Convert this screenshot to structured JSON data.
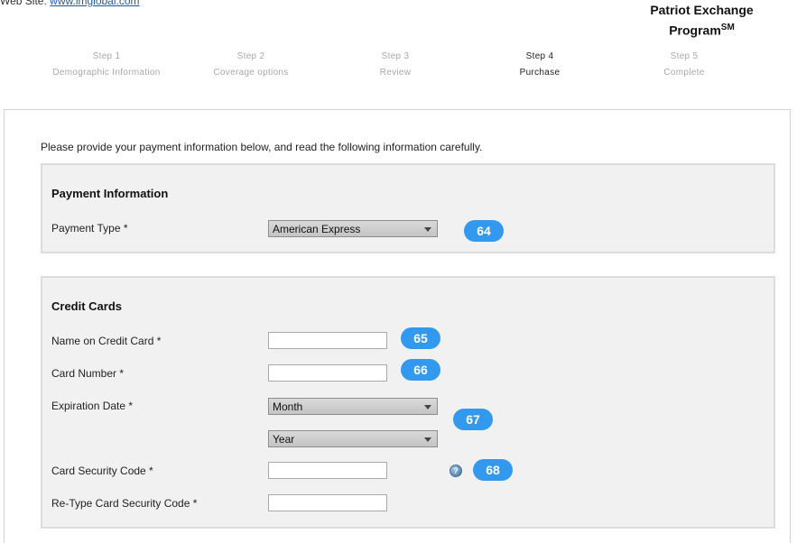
{
  "header": {
    "website_label": "Web Site:",
    "website_link": "www.imglobal.com",
    "program_name": "Patriot Exchange",
    "program_line2": "Program",
    "program_superscript": "SM"
  },
  "steps": [
    {
      "num": "Step 1",
      "label": "Demographic Information"
    },
    {
      "num": "Step 2",
      "label": "Coverage options"
    },
    {
      "num": "Step 3",
      "label": "Review"
    },
    {
      "num": "Step 4",
      "label": "Purchase"
    },
    {
      "num": "Step 5",
      "label": "Complete"
    }
  ],
  "active_step": 4,
  "intro": "Please provide your payment information below, and read the following information carefully.",
  "payment": {
    "title": "Payment Information",
    "type_label": "Payment Type *",
    "type_value": "American Express",
    "badge": "64"
  },
  "credit": {
    "title": "Credit Cards",
    "name_label": "Name on Credit Card *",
    "name_value": "",
    "name_badge": "65",
    "number_label": "Card Number *",
    "number_value": "",
    "number_badge": "66",
    "expiration_label": "Expiration Date *",
    "month_value": "Month",
    "year_value": "Year",
    "expiration_badge": "67",
    "security_label": "Card Security Code *",
    "security_value": "",
    "security_badge": "68",
    "help_glyph": "?",
    "retype_label": "Re-Type Card Security Code *",
    "retype_value": ""
  },
  "colors": {
    "badge": "#3399ee",
    "panel_bg": "#f1f1f1",
    "link": "#1a5ea8"
  }
}
